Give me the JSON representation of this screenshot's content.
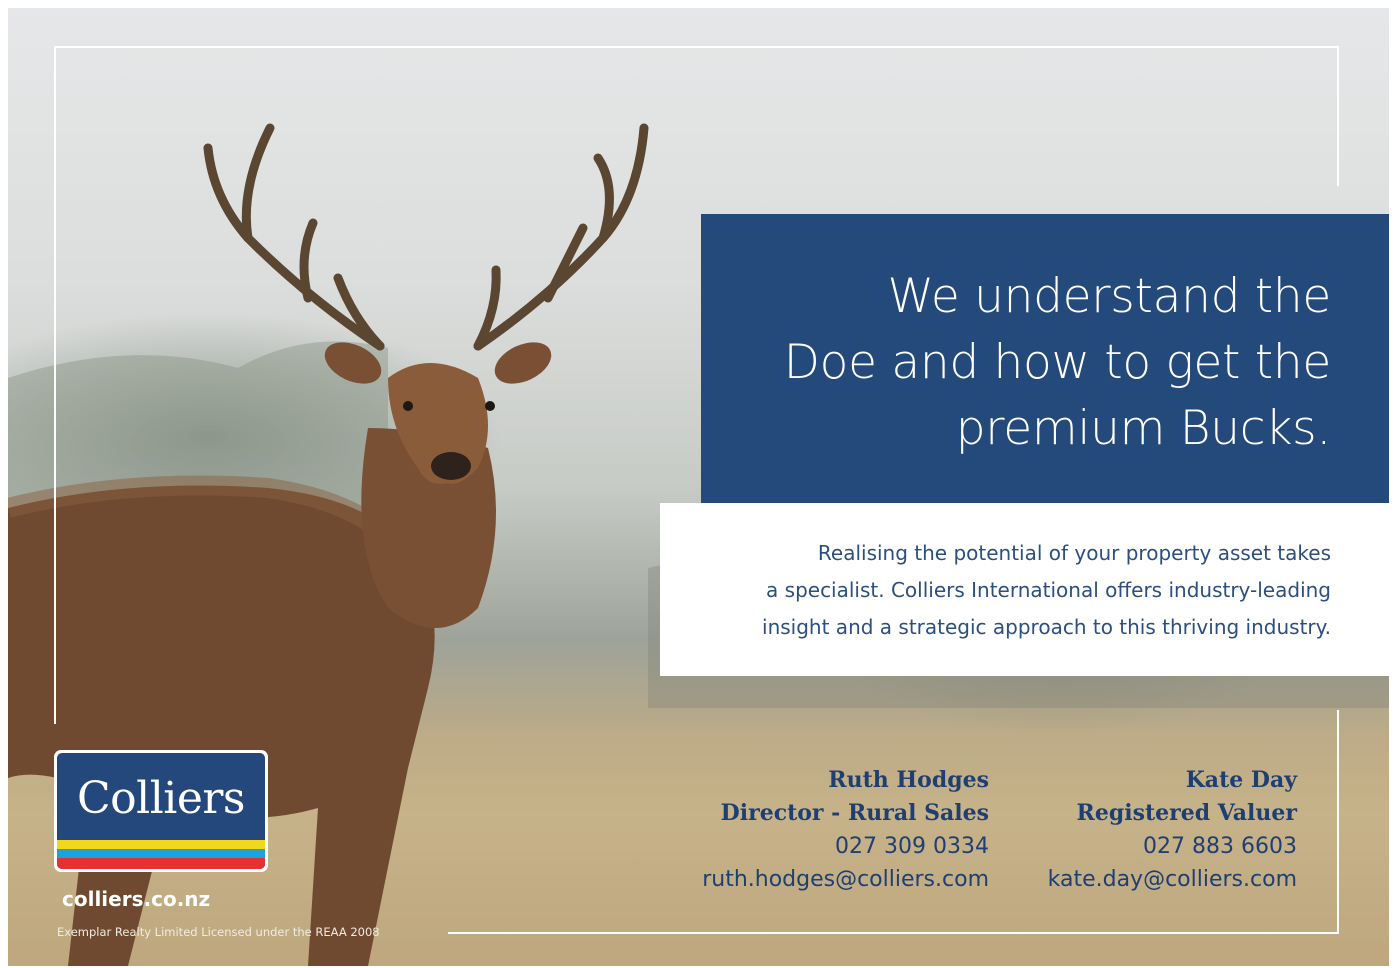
{
  "headline": {
    "line1": "We understand the",
    "line2": "Doe and how to get the",
    "line3": "premium Bucks."
  },
  "body": {
    "line1": "Realising the potential of your property asset takes",
    "line2": "a specialist. Colliers International offers industry-leading",
    "line3": "insight and a strategic approach to this thriving industry."
  },
  "contacts": [
    {
      "name": "Ruth Hodges",
      "role": "Director - Rural Sales",
      "phone": "027 309 0334",
      "email": "ruth.hodges@colliers.com"
    },
    {
      "name": "Kate Day",
      "role": "Registered Valuer",
      "phone": "027 883 6603",
      "email": "kate.day@colliers.com"
    }
  ],
  "logo": {
    "text": "Colliers"
  },
  "website": "colliers.co.nz",
  "license": "Exemplar Realty Limited Licensed under the REAA 2008",
  "colors": {
    "brand_blue": "#244a7c",
    "stripe_yellow": "#f2d81b",
    "stripe_blue": "#1ea2dc",
    "stripe_red": "#e5312f",
    "text_blue": "#1f3f72"
  },
  "image": {
    "subject": "red deer stag with large antlers in misty field"
  }
}
